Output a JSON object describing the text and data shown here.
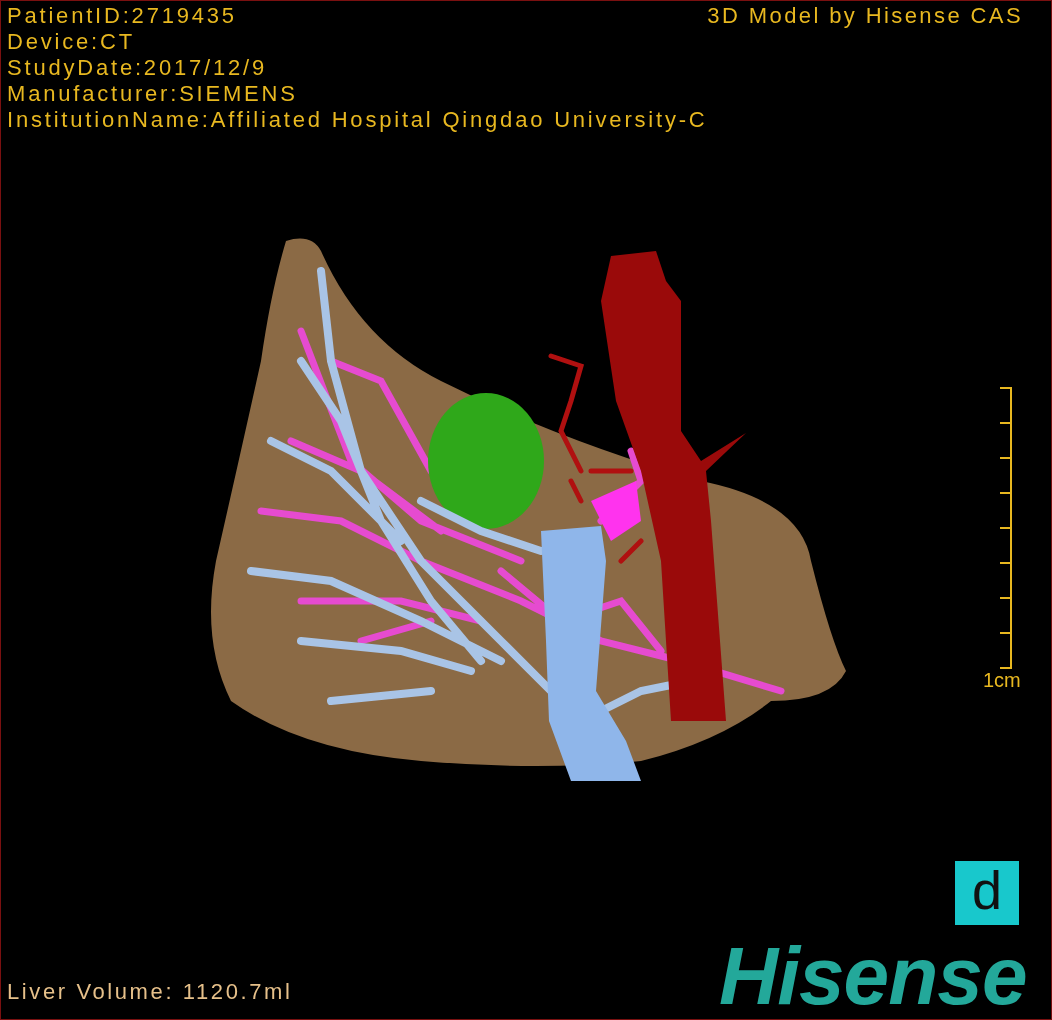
{
  "patient_info": [
    "PatientID:2719435",
    "Device:CT",
    "StudyDate:2017/12/9",
    "Manufacturer:SIEMENS",
    "InstitutionName:Affiliated Hospital Qingdao University-C"
  ],
  "header_right": "3D Model by Hisense CAS",
  "scale_bar": {
    "label": "1cm"
  },
  "view_button": {
    "label": "d"
  },
  "liver_volume": "Liver Volume: 1120.7ml",
  "logo": "Hisense"
}
